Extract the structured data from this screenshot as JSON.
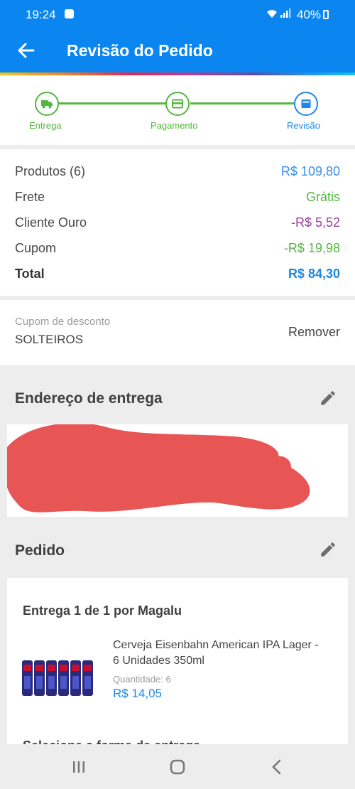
{
  "status_bar": {
    "time": "19:24",
    "battery": "40%"
  },
  "header": {
    "title": "Revisão do Pedido"
  },
  "stepper": {
    "steps": [
      {
        "label": "Entrega",
        "icon": "truck-icon",
        "state": "done"
      },
      {
        "label": "Pagamento",
        "icon": "card-icon",
        "state": "done"
      },
      {
        "label": "Revisão",
        "icon": "review-icon",
        "state": "current"
      }
    ]
  },
  "summary": {
    "rows": [
      {
        "label": "Produtos (6)",
        "value": "R$ 109,80",
        "color": "#3a8ee6"
      },
      {
        "label": "Frete",
        "value": "Grátis",
        "color": "#55b640"
      },
      {
        "label": "Cliente Ouro",
        "value": "-R$ 5,52",
        "color": "#9c3f9c"
      },
      {
        "label": "Cupom",
        "value": "-R$ 19,98",
        "color": "#55b640"
      },
      {
        "label": "Total",
        "value": "R$ 84,30",
        "color": "#1e88e5"
      }
    ]
  },
  "coupon": {
    "label": "Cupom de desconto",
    "code": "SOLTEIROS",
    "remove_label": "Remover"
  },
  "address_section": {
    "title": "Endereço de entrega"
  },
  "order_section": {
    "title": "Pedido",
    "delivery_title": "Entrega 1 de 1 por Magalu",
    "product": {
      "name": "Cerveja Eisenbahn American IPA Lager - 6 Unidades 350ml",
      "quantity_label": "Quantidade:",
      "quantity_value": "6",
      "price": "R$ 14,05"
    },
    "cut_off_text": "Selecione a forma de entrega"
  },
  "colors": {
    "primary": "#0b86f0",
    "success": "#55b640",
    "accent": "#1e88e5",
    "redaction": "#e85555"
  }
}
